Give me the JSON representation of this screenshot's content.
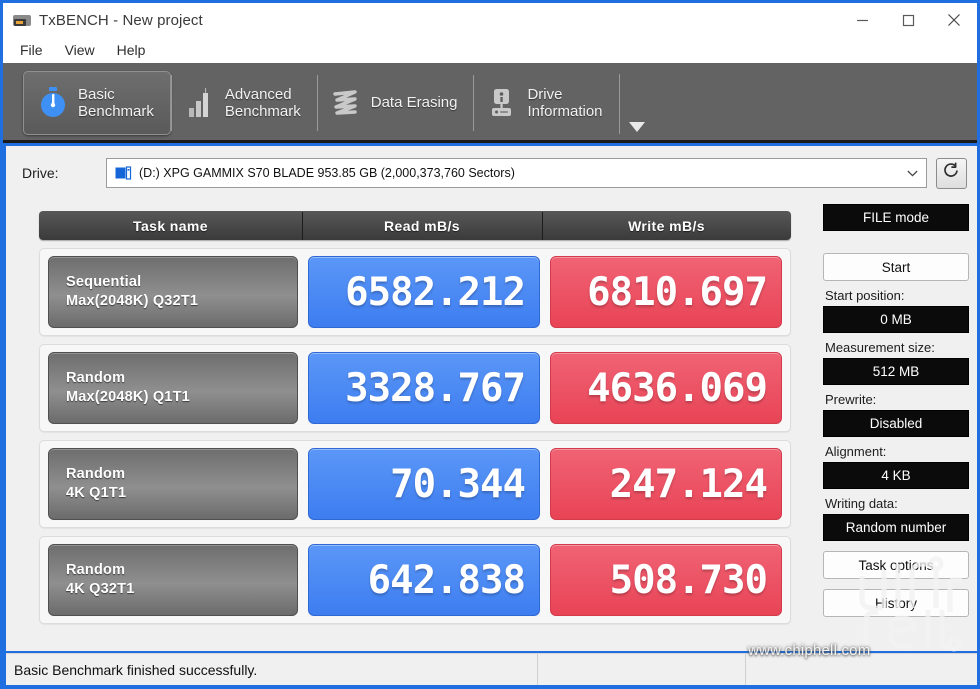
{
  "window": {
    "title": "TxBENCH - New project",
    "icon": "app-icon",
    "controls": {
      "minimize": "minimize-icon",
      "maximize": "maximize-icon",
      "close": "close-icon"
    }
  },
  "menu": {
    "items": [
      {
        "label": "File"
      },
      {
        "label": "View"
      },
      {
        "label": "Help"
      }
    ]
  },
  "tabs": [
    {
      "label": "Basic\nBenchmark",
      "icon": "stopwatch-icon",
      "active": true
    },
    {
      "label": "Advanced\nBenchmark",
      "icon": "bar-chart-icon",
      "active": false
    },
    {
      "label": "Data Erasing",
      "icon": "shredder-icon",
      "active": false
    },
    {
      "label": "Drive\nInformation",
      "icon": "drive-info-icon",
      "active": false
    }
  ],
  "tab_overflow": {
    "icon": "chevron-down-icon"
  },
  "drive": {
    "label": "Drive:",
    "selected": "(D:) XPG GAMMIX S70 BLADE  953.85 GB (2,000,373,760 Sectors)",
    "chevron": "chevron-down-icon",
    "refresh": "refresh-icon"
  },
  "results": {
    "headers": {
      "task": "Task name",
      "read": "Read mB/s",
      "write": "Write mB/s"
    },
    "rows": [
      {
        "name_line1": "Sequential",
        "name_line2": "Max(2048K) Q32T1",
        "read": "6582.212",
        "write": "6810.697"
      },
      {
        "name_line1": "Random",
        "name_line2": "Max(2048K) Q1T1",
        "read": "3328.767",
        "write": "4636.069"
      },
      {
        "name_line1": "Random",
        "name_line2": "4K Q1T1",
        "read": "70.344",
        "write": "247.124"
      },
      {
        "name_line1": "Random",
        "name_line2": "4K Q32T1",
        "read": "642.838",
        "write": "508.730"
      }
    ]
  },
  "sidebar": {
    "mode": "FILE mode",
    "start_button": "Start",
    "start_position_label": "Start position:",
    "start_position_value": "0 MB",
    "measurement_size_label": "Measurement size:",
    "measurement_size_value": "512 MB",
    "prewrite_label": "Prewrite:",
    "prewrite_value": "Disabled",
    "alignment_label": "Alignment:",
    "alignment_value": "4 KB",
    "writing_data_label": "Writing data:",
    "writing_data_value": "Random number",
    "task_options_button": "Task options",
    "history_button": "History"
  },
  "status": {
    "message": "Basic Benchmark finished successfully."
  },
  "watermark": {
    "text": "www.chiphell.com"
  },
  "colors": {
    "read_blue": "#4d8df5",
    "write_red": "#ec5263",
    "tabstrip_gray": "#636363",
    "window_accent": "#1f6fe0",
    "dark_field": "#0b0b0b"
  }
}
